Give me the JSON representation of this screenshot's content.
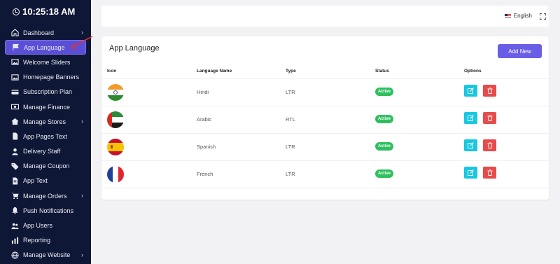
{
  "sidebar": {
    "clock": "10:25:18 AM",
    "items": [
      {
        "label": "Dashboard",
        "icon": "home-icon",
        "chevron": true
      },
      {
        "label": "App Language",
        "icon": "flag-icon",
        "active": true
      },
      {
        "label": "Welcome Sliders",
        "icon": "image-icon"
      },
      {
        "label": "Homepage Banners",
        "icon": "image-icon"
      },
      {
        "label": "Subscription Plan",
        "icon": "card-icon"
      },
      {
        "label": "Manage Finance",
        "icon": "money-icon"
      },
      {
        "label": "Manage Stores",
        "icon": "store-icon",
        "chevron": true
      },
      {
        "label": "App Pages Text",
        "icon": "file-icon"
      },
      {
        "label": "Delivery Staff",
        "icon": "user-icon"
      },
      {
        "label": "Manage Coupon",
        "icon": "tag-icon"
      },
      {
        "label": "App Text",
        "icon": "text-file-icon"
      },
      {
        "label": "Manage Orders",
        "icon": "cart-icon",
        "chevron": true
      },
      {
        "label": "Push Notifications",
        "icon": "bell-icon"
      },
      {
        "label": "App Users",
        "icon": "users-icon"
      },
      {
        "label": "Reporting",
        "icon": "chart-icon"
      },
      {
        "label": "Manage Website",
        "icon": "globe-icon",
        "chevron": true
      }
    ]
  },
  "topbar": {
    "language": "English"
  },
  "main": {
    "title": "App Language",
    "add_button": "Add New",
    "columns": [
      "Icon",
      "Language Name",
      "Type",
      "Status",
      "Options"
    ],
    "rows": [
      {
        "flag": "india-flag-icon",
        "name": "Hindi",
        "type": "LTR",
        "status": "Active"
      },
      {
        "flag": "uae-flag-icon",
        "name": "Arabic",
        "type": "RTL",
        "status": "Active"
      },
      {
        "flag": "spain-flag-icon",
        "name": "Spanish",
        "type": "LTR",
        "status": "Active"
      },
      {
        "flag": "france-flag-icon",
        "name": "French",
        "type": "LTR",
        "status": "Active"
      }
    ]
  },
  "colors": {
    "sidebar": "#0f1736",
    "accent": "#6a5ee6",
    "active": "#2fbf5f",
    "edit": "#19c7e0",
    "delete": "#e84b4b"
  }
}
